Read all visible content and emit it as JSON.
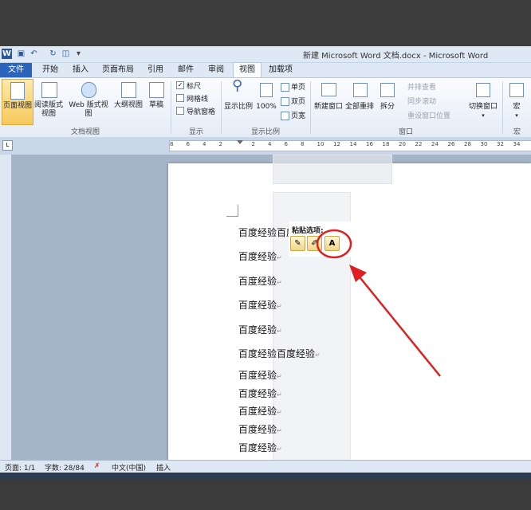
{
  "window": {
    "title": "新建 Microsoft Word 文档.docx - Microsoft Word"
  },
  "quick_access": {
    "icons": [
      "word-logo-icon",
      "save-icon",
      "undo-icon",
      "redo-icon",
      "print-preview-icon",
      "customize-icon"
    ]
  },
  "tabs": [
    "文件",
    "开始",
    "插入",
    "页面布局",
    "引用",
    "邮件",
    "审阅",
    "视图",
    "加载项"
  ],
  "active_tab": "视图",
  "ribbon": {
    "doc_views": {
      "label": "文档视图",
      "buttons": [
        "页面视图",
        "阅读版式\n视图",
        "Web 版式视图",
        "大纲视图",
        "草稿"
      ]
    },
    "show": {
      "label": "显示",
      "ruler": "标尺",
      "gridlines": "网格线",
      "nav_pane": "导航窗格",
      "ruler_checked": true
    },
    "zoom": {
      "label": "显示比例",
      "zoom_btn": "显示比例",
      "pct_btn": "100%",
      "one_page": "单页",
      "two_pages": "双页",
      "page_width": "页宽"
    },
    "window": {
      "label": "窗口",
      "new_window": "新建窗口",
      "arrange_all": "全部重排",
      "split": "拆分",
      "side_by_side": "并排查看",
      "sync_scroll": "同步滚动",
      "reset_pos": "重设窗口位置",
      "switch_windows": "切换窗口"
    },
    "macros": {
      "label": "宏",
      "btn": "宏"
    }
  },
  "ruler_ticks": [
    "8",
    "6",
    "4",
    "2",
    "",
    "2",
    "4",
    "6",
    "8",
    "10",
    "12",
    "14",
    "16",
    "18",
    "20",
    "22",
    "24",
    "26",
    "28",
    "30",
    "32",
    "34"
  ],
  "document": {
    "lines": [
      "百度经验百度",
      "百度经验",
      "百度经验",
      "百度经验",
      "百度经验",
      "百度经验百度经验",
      "百度经验",
      "百度经验",
      "百度经验",
      "百度经验",
      "百度经验"
    ]
  },
  "paste_options": {
    "label": "粘贴选项:",
    "keep_text_only": "A"
  },
  "status": {
    "page": "页面: 1/1",
    "words": "字数: 28/84",
    "language": "中文(中国)",
    "mode": "插入"
  },
  "colors": {
    "annotation": "#e02020",
    "file_tab": "#2a64bc"
  }
}
